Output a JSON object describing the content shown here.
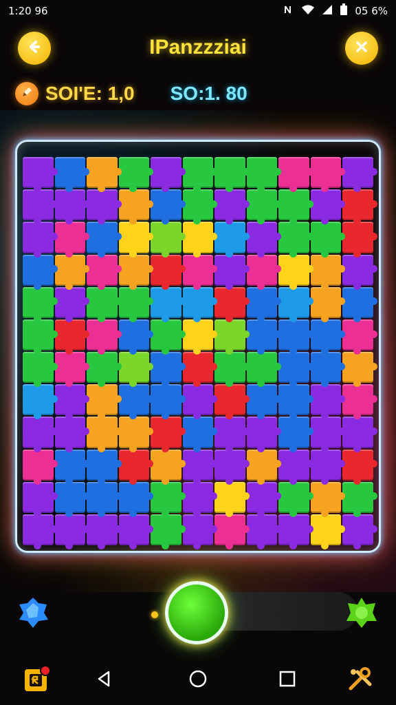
{
  "status_bar": {
    "time": "1:20 96",
    "battery": "05 6%"
  },
  "header": {
    "title": "IPanzzziai"
  },
  "score": {
    "left_text": "SOI'E: 1,0",
    "right_text": "SO:1. 80"
  },
  "colors": {
    "title": "#ffe23a",
    "score_left": "#ffd84a",
    "score_right": "#7fe8ff",
    "board_border": "#cfe9ff",
    "pieces": [
      "#8a2be2",
      "#1f6fe0",
      "#f5a320",
      "#27c840",
      "#ec2f95",
      "#e8282e",
      "#7bd62a",
      "#1e9be8",
      "#ffd31a"
    ]
  },
  "board": {
    "cols": 11,
    "rows": 12,
    "pieces": [
      [
        0,
        1,
        2,
        3,
        0,
        3,
        3,
        3,
        4,
        4,
        0
      ],
      [
        0,
        0,
        0,
        2,
        1,
        3,
        0,
        3,
        3,
        0,
        5
      ],
      [
        0,
        4,
        1,
        8,
        6,
        8,
        7,
        0,
        3,
        3,
        5
      ],
      [
        1,
        2,
        4,
        2,
        5,
        4,
        0,
        4,
        8,
        2,
        0
      ],
      [
        3,
        0,
        3,
        3,
        7,
        7,
        5,
        1,
        7,
        2,
        1
      ],
      [
        3,
        5,
        4,
        1,
        3,
        8,
        6,
        1,
        1,
        1,
        4
      ],
      [
        3,
        4,
        3,
        6,
        1,
        5,
        3,
        3,
        1,
        1,
        2
      ],
      [
        7,
        0,
        2,
        1,
        1,
        0,
        5,
        1,
        1,
        0,
        4
      ],
      [
        0,
        0,
        2,
        2,
        5,
        1,
        0,
        0,
        1,
        0,
        0
      ],
      [
        4,
        1,
        1,
        5,
        2,
        0,
        0,
        2,
        0,
        0,
        5
      ],
      [
        0,
        1,
        1,
        1,
        3,
        0,
        8,
        0,
        3,
        2,
        3
      ],
      [
        0,
        0,
        0,
        0,
        3,
        0,
        4,
        0,
        0,
        8,
        0
      ]
    ]
  },
  "controls": {
    "progress": 0.0
  },
  "icons": {
    "back": "back-arrow-icon",
    "close": "close-icon",
    "pencil": "pencil-icon",
    "left_gem": "blue-gem-icon",
    "right_gem": "green-gem-icon",
    "nav": [
      "store-icon",
      "back-triangle-icon",
      "home-circle-icon",
      "recents-square-icon",
      "tools-icon"
    ]
  }
}
